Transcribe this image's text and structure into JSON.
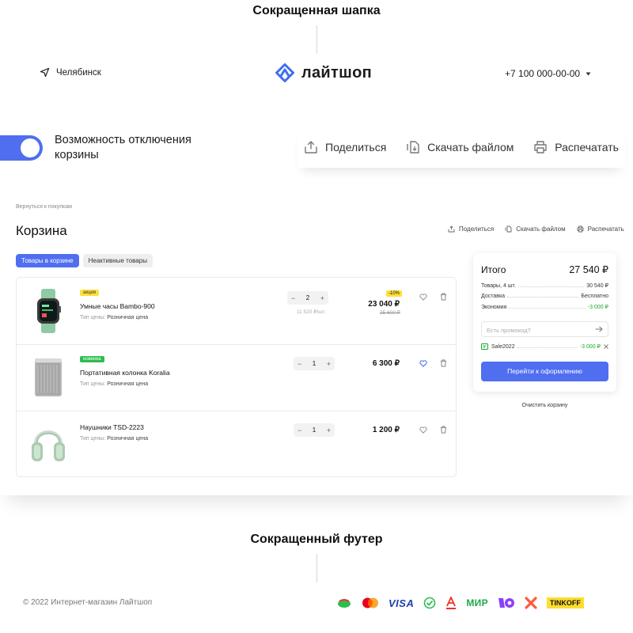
{
  "sections": {
    "header_title": "Сокращенная шапка",
    "footer_title": "Сокращенный футер"
  },
  "header": {
    "city": "Челябинск",
    "logo_text": "лайтшоп",
    "phone": "+7 100 000-00-00"
  },
  "toggle": {
    "label": "Возможность отключения корзины",
    "on": true
  },
  "big_actions": {
    "share": "Поделиться",
    "download": "Скачать файлом",
    "print": "Распечатать"
  },
  "cart": {
    "back_link": "Вернуться к покупкам",
    "title": "Корзина",
    "actions": {
      "share": "Поделиться",
      "download": "Скачать файлом",
      "print": "Распечатать"
    },
    "tabs": {
      "active": "Товары в корзине",
      "inactive": "Неактивные товары"
    },
    "price_type_label": "Тип цены:",
    "items": [
      {
        "badge": "акция",
        "name": "Умные часы Bambo-900",
        "price_type": "Розничная цена",
        "qty": "2",
        "unit_price": "11 520 ₽/шт.",
        "discount": "-10%",
        "price": "23 040 ₽",
        "old_price": "25 600 ₽",
        "favorite": false
      },
      {
        "badge": "новинка",
        "name": "Портативная колонка Koralia",
        "price_type": "Розничная цена",
        "qty": "1",
        "price": "6 300 ₽",
        "favorite": true
      },
      {
        "name": "Наушники TSD-2223",
        "price_type": "Розничная цена",
        "qty": "1",
        "price": "1 200 ₽",
        "favorite": false
      }
    ]
  },
  "summary": {
    "title": "Итого",
    "total": "27 540 ₽",
    "lines": [
      {
        "label": "Товары, 4 шт.",
        "value": "30 540 ₽"
      },
      {
        "label": "Доставка",
        "value": "Бесплатно"
      },
      {
        "label": "Экономия",
        "value": "-3 000 ₽"
      }
    ],
    "promo_placeholder": "Есть промокод?",
    "coupon": {
      "code": "Sale2022",
      "value": "-3 000 ₽"
    },
    "checkout": "Перейти к оформлению",
    "clear": "Очистить корзину"
  },
  "footer": {
    "copyright": "© 2022 Интернет-магазин Лайтшоп",
    "payments": [
      "sber-spasibo",
      "mastercard",
      "VISA",
      "sbp",
      "alfa",
      "МИР",
      "yoomoney",
      "halva",
      "TINKOFF"
    ]
  },
  "colors": {
    "accent": "#4f6ef0",
    "badge_sale": "#ffe03a",
    "badge_new": "#2ebd4f",
    "savings": "#1aaa2b",
    "text": "#1c1c1c"
  }
}
